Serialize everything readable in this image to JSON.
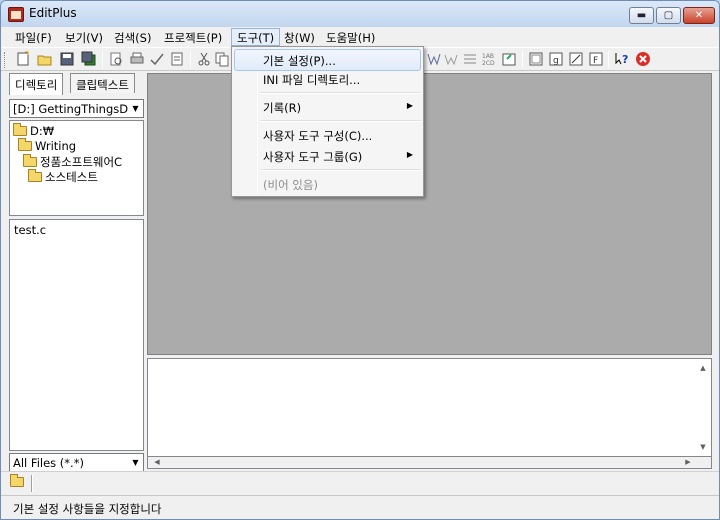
{
  "window": {
    "title": "EditPlus",
    "minimize": "▬",
    "maximize": "▢",
    "close": "✕"
  },
  "menubar": {
    "items": [
      {
        "label": "파일(F)"
      },
      {
        "label": "보기(V)"
      },
      {
        "label": "검색(S)"
      },
      {
        "label": "프로젝트(P)"
      },
      {
        "label": "도구(T)"
      },
      {
        "label": "창(W)"
      },
      {
        "label": "도움말(H)"
      }
    ],
    "active_index": 4
  },
  "toolbar": {
    "icons": [
      "new-file-icon",
      "open-folder-icon",
      "save-icon",
      "save-all-icon",
      "print-preview-icon",
      "print-icon",
      "spell-check-icon",
      "properties-icon",
      "cut-icon",
      "copy-icon",
      "word-wrap-icon",
      "wrap-indicator-icon",
      "line-numbers-icon",
      "column-select-icon",
      "toggle-output-icon",
      "fullscreen-icon",
      "help-icon",
      "stop-icon"
    ]
  },
  "left_panel": {
    "tabs": [
      {
        "label": "디렉토리"
      },
      {
        "label": "클립텍스트"
      }
    ],
    "drive": "[D:] GettingThingsDor",
    "tree": [
      {
        "label": "D:₩",
        "depth": 0
      },
      {
        "label": "Writing",
        "depth": 1
      },
      {
        "label": "정품소프트웨어C",
        "depth": 2
      },
      {
        "label": "소스테스트",
        "depth": 3
      }
    ],
    "files": [
      "test.c"
    ],
    "filter": "All Files (*.*)"
  },
  "tools_menu": {
    "items": [
      {
        "label": "기본 설정(P)...",
        "hover": true
      },
      {
        "label": "INI 파일 디렉토리..."
      },
      {
        "label": "기록(R)",
        "submenu": true
      },
      {
        "label": "사용자 도구 구성(C)..."
      },
      {
        "label": "사용자 도구 그룹(G)",
        "submenu": true
      },
      {
        "label": "(비어 있음)",
        "disabled": true
      }
    ]
  },
  "statusbar": {
    "text": "기본 설정 사항들을 지정합니다"
  },
  "colors": {
    "editor_bg": "#ababab",
    "menu_hover": "#e1ebf9",
    "close_red": "#c8412b"
  }
}
